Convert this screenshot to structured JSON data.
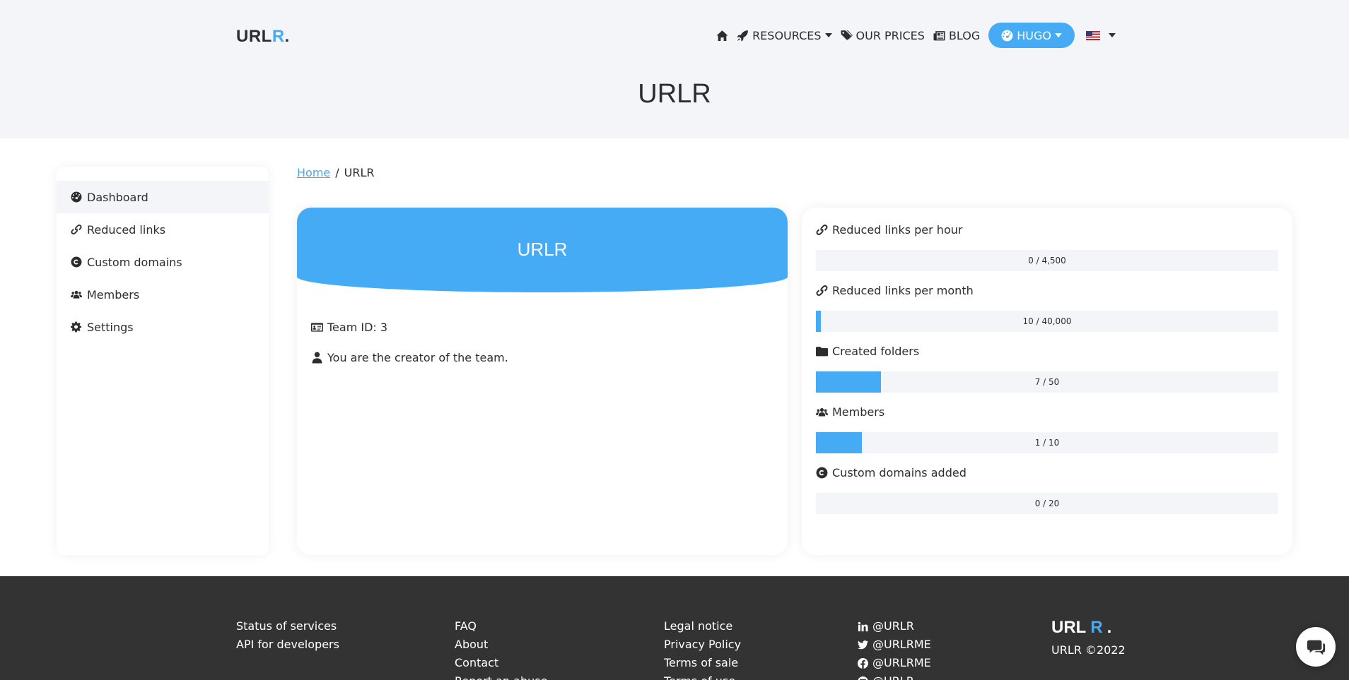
{
  "header": {
    "logo_main": "URL",
    "logo_accent": "R",
    "logo_dot": ".",
    "nav": {
      "resources": "RESOURCES",
      "prices": "OUR PRICES",
      "blog": "BLOG",
      "user": "HUGO"
    },
    "page_title": "URLR"
  },
  "sidebar": {
    "items": [
      {
        "label": "Dashboard",
        "icon": "dashboard-icon",
        "active": true
      },
      {
        "label": "Reduced links",
        "icon": "link-icon"
      },
      {
        "label": "Custom domains",
        "icon": "copyright-icon"
      },
      {
        "label": "Members",
        "icon": "users-icon"
      },
      {
        "label": "Settings",
        "icon": "gear-icon"
      }
    ]
  },
  "breadcrumb": {
    "home": "Home",
    "separator": "/",
    "current": "URLR"
  },
  "team": {
    "name": "URLR",
    "team_id": "Team ID: 3",
    "role": "You are the creator of the team."
  },
  "stats": [
    {
      "label": "Reduced links per hour",
      "icon": "link-icon",
      "used": 0,
      "limit": 4500,
      "text": "0 / 4,500"
    },
    {
      "label": "Reduced links per month",
      "icon": "link-icon",
      "used": 10,
      "limit": 40000,
      "text": "10 / 40,000"
    },
    {
      "label": "Created folders",
      "icon": "folder-icon",
      "used": 7,
      "limit": 50,
      "text": "7 / 50"
    },
    {
      "label": "Members",
      "icon": "users-icon",
      "used": 1,
      "limit": 10,
      "text": "1 / 10"
    },
    {
      "label": "Custom domains added",
      "icon": "copyright-icon",
      "used": 0,
      "limit": 20,
      "text": "0 / 20"
    }
  ],
  "colors": {
    "accent": "#45abf5",
    "header_bg": "#f4f5f9",
    "footer_bg": "#333333"
  },
  "footer": {
    "col1": [
      "Status of services",
      "API for developers"
    ],
    "col2": [
      "FAQ",
      "About",
      "Contact",
      "Report an abuse"
    ],
    "col3": [
      "Legal notice",
      "Privacy Policy",
      "Terms of sale",
      "Terms of use"
    ],
    "social": [
      {
        "icon": "linkedin-icon",
        "handle": "@URLR"
      },
      {
        "icon": "twitter-icon",
        "handle": "@URLRME"
      },
      {
        "icon": "facebook-icon",
        "handle": "@URLRME"
      },
      {
        "icon": "github-icon",
        "handle": "@URLR"
      }
    ],
    "copyright": "URLR ©2022"
  }
}
